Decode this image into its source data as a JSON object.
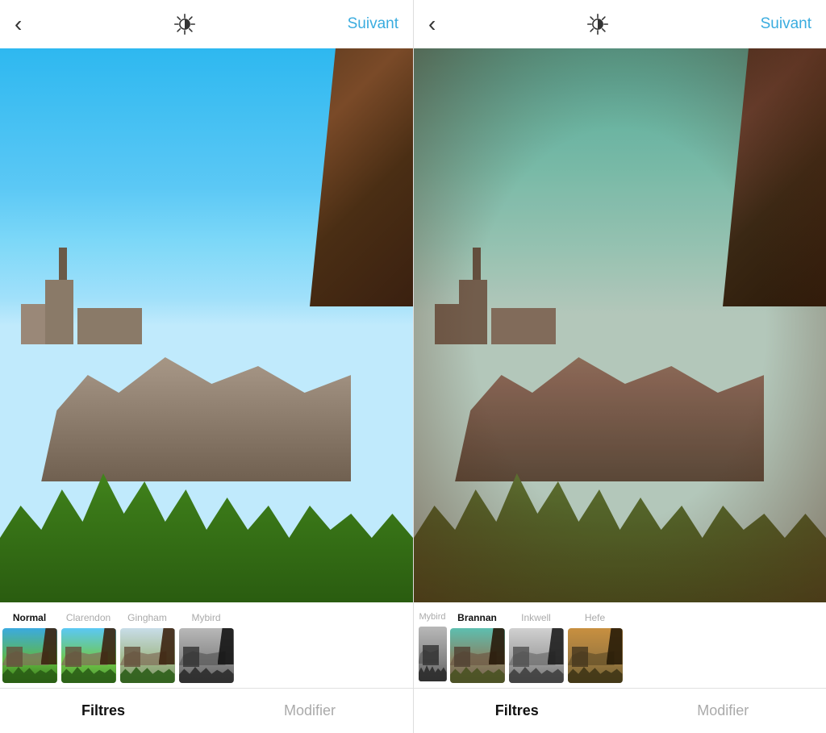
{
  "panels": [
    {
      "id": "left",
      "header": {
        "back_label": "‹",
        "next_label": "Suivant",
        "title": ""
      },
      "filter": "Normal",
      "filter_strip": [
        {
          "id": "normal",
          "label": "Normal",
          "active": true,
          "thumb_class": "thumb-normal"
        },
        {
          "id": "clarendon",
          "label": "Clarendon",
          "active": false,
          "thumb_class": "thumb-clarendon"
        },
        {
          "id": "gingham",
          "label": "Gingham",
          "active": false,
          "thumb_class": "thumb-gingham"
        },
        {
          "id": "mybird",
          "label": "Mybird",
          "active": false,
          "thumb_class": "thumb-mybird"
        }
      ],
      "nav": [
        {
          "id": "filtres",
          "label": "Filtres",
          "active": true
        },
        {
          "id": "modifier",
          "label": "Modifier",
          "active": false
        }
      ]
    },
    {
      "id": "right",
      "header": {
        "back_label": "‹",
        "next_label": "Suivant",
        "title": ""
      },
      "filter": "Brannan",
      "filter_strip": [
        {
          "id": "brannan",
          "label": "Brannan",
          "active": true,
          "thumb_class": "thumb-brannan"
        },
        {
          "id": "inkwell",
          "label": "Inkwell",
          "active": false,
          "thumb_class": "thumb-inkwell"
        },
        {
          "id": "hefe",
          "label": "Hefe",
          "active": false,
          "thumb_class": "thumb-hefe"
        }
      ],
      "nav": [
        {
          "id": "filtres",
          "label": "Filtres",
          "active": true
        },
        {
          "id": "modifier",
          "label": "Modifier",
          "active": false
        }
      ]
    }
  ],
  "icons": {
    "back": "‹",
    "brightness": "◑"
  }
}
